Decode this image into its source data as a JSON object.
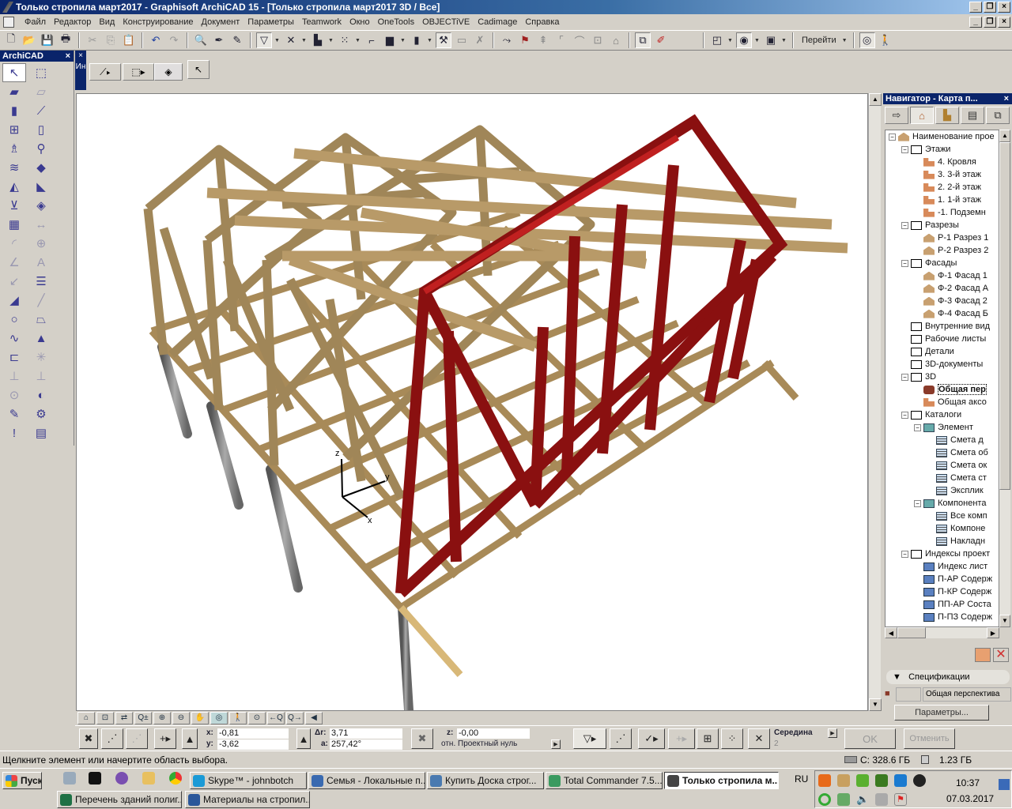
{
  "window": {
    "title": "Только стропила март2017 - Graphisoft ArchiCAD 15 - [Только стропила март2017 3D / Все]",
    "min_icon": "minimize-icon",
    "restore_icon": "restore-icon",
    "close_icon": "close-icon"
  },
  "menu": [
    "Файл",
    "Редактор",
    "Вид",
    "Конструирование",
    "Документ",
    "Параметры",
    "Teamwork",
    "Окно",
    "OneTools",
    "OBJECTiVE",
    "Cadimage",
    "Справка"
  ],
  "toolbar": {
    "goto_label": "Перейти",
    "icons": [
      "new-file",
      "open-file",
      "save",
      "print",
      "cut",
      "copy",
      "paste",
      "undo",
      "redo",
      "find-select",
      "eyedropper",
      "syringe",
      "magic-wand",
      "trim",
      "elevation",
      "snap-grid",
      "ruler-grid",
      "layers",
      "element-height",
      "magic-select",
      "coordinate-grid",
      "close-tool",
      "offset",
      "drag",
      "lift",
      "corner",
      "curve",
      "group",
      "house",
      "3d-window",
      "pen-sets"
    ]
  },
  "palette": {
    "title": "ArchiCAD",
    "close": "×",
    "tools": [
      {
        "name": "arrow-tool",
        "glyph": "↖",
        "sel": true
      },
      {
        "name": "marquee-tool",
        "glyph": "⬚"
      },
      {
        "name": "wall-tool",
        "glyph": "▰"
      },
      {
        "name": "curtain-wall-tool",
        "glyph": "▱",
        "dim": true
      },
      {
        "name": "column-tool",
        "glyph": "▮"
      },
      {
        "name": "beam-tool",
        "glyph": "⟋"
      },
      {
        "name": "window-tool",
        "glyph": "⊞"
      },
      {
        "name": "door-tool",
        "glyph": "▯"
      },
      {
        "name": "object-tool",
        "glyph": "♗"
      },
      {
        "name": "lamp-tool",
        "glyph": "⚲"
      },
      {
        "name": "stair-tool",
        "glyph": "≋"
      },
      {
        "name": "slab-tool",
        "glyph": "◆"
      },
      {
        "name": "roof-tool",
        "glyph": "◭"
      },
      {
        "name": "shell-tool",
        "glyph": "◣"
      },
      {
        "name": "mesh-tool",
        "glyph": "⊻"
      },
      {
        "name": "zone-tool",
        "glyph": "◈"
      },
      {
        "name": "grid-tool",
        "glyph": "▦"
      },
      {
        "name": "dimension-tool",
        "glyph": "↔",
        "dim": true
      },
      {
        "name": "radial-dimension-tool",
        "glyph": "◜",
        "dim": true
      },
      {
        "name": "level-dimension-tool",
        "glyph": "⊕",
        "dim": true
      },
      {
        "name": "angle-dimension-tool",
        "glyph": "∠",
        "dim": true
      },
      {
        "name": "text-tool",
        "glyph": "A",
        "dim": true
      },
      {
        "name": "label-tool",
        "glyph": "↙",
        "dim": true
      },
      {
        "name": "section-marker-tool",
        "glyph": "☰"
      },
      {
        "name": "fill-tool",
        "glyph": "◢"
      },
      {
        "name": "line-tool",
        "glyph": "╱",
        "dim": true
      },
      {
        "name": "circle-tool",
        "glyph": "○"
      },
      {
        "name": "polyline-tool",
        "glyph": "⏢"
      },
      {
        "name": "spline-tool",
        "glyph": "∿"
      },
      {
        "name": "figure-tool",
        "glyph": "▲"
      },
      {
        "name": "section-tool",
        "glyph": "⊏"
      },
      {
        "name": "hotspot-tool",
        "glyph": "✳",
        "dim": true
      },
      {
        "name": "elevation-tool",
        "glyph": "⊥",
        "dim": true
      },
      {
        "name": "interior-elevation-tool",
        "glyph": "⊥",
        "dim": true
      },
      {
        "name": "detail-tool",
        "glyph": "⊙",
        "dim": true
      },
      {
        "name": "worksheet-tool",
        "glyph": "◐"
      },
      {
        "name": "change-tool",
        "glyph": "✎"
      },
      {
        "name": "camera-tool",
        "glyph": "⚙"
      },
      {
        "name": "revision-tool",
        "glyph": "!"
      },
      {
        "name": "drawing-tool",
        "glyph": "▤"
      }
    ]
  },
  "infobox": {
    "vertical_label": "Ин",
    "close": "×"
  },
  "axes": {
    "x": "x",
    "y": "y",
    "z": "z"
  },
  "viewbar_icons": [
    "navigator-preview",
    "zoom-window",
    "fit",
    "zoom-pm",
    "zoom-in",
    "zoom-out",
    "pan",
    "orbit",
    "walk",
    "fit-in-window",
    "previous-zoom",
    "next-zoom",
    "scroll-left"
  ],
  "navigator": {
    "title": "Навигатор - Карта п...",
    "close": "×",
    "tree": [
      {
        "d": 0,
        "t": "-",
        "i": "house",
        "l": "Наименование прое"
      },
      {
        "d": 1,
        "t": "-",
        "i": "box",
        "l": "Этажи"
      },
      {
        "d": 2,
        "i": "story",
        "l": "4. Кровля"
      },
      {
        "d": 2,
        "i": "story",
        "l": "3. 3-й этаж"
      },
      {
        "d": 2,
        "i": "story",
        "l": "2. 2-й этаж"
      },
      {
        "d": 2,
        "i": "story",
        "l": "1. 1-й этаж"
      },
      {
        "d": 2,
        "i": "story",
        "l": "-1. Подземн"
      },
      {
        "d": 1,
        "t": "-",
        "i": "box",
        "l": "Разрезы"
      },
      {
        "d": 2,
        "i": "house",
        "l": "Р-1 Разрез 1"
      },
      {
        "d": 2,
        "i": "house",
        "l": "Р-2 Разрез 2"
      },
      {
        "d": 1,
        "t": "-",
        "i": "box",
        "l": "Фасады"
      },
      {
        "d": 2,
        "i": "house",
        "l": "Ф-1 Фасад 1"
      },
      {
        "d": 2,
        "i": "house",
        "l": "Ф-2 Фасад А"
      },
      {
        "d": 2,
        "i": "house",
        "l": "Ф-3 Фасад 2"
      },
      {
        "d": 2,
        "i": "house",
        "l": "Ф-4 Фасад Б"
      },
      {
        "d": 1,
        "i": "box",
        "l": "Внутренние вид"
      },
      {
        "d": 1,
        "i": "sheet",
        "l": "Рабочие листы"
      },
      {
        "d": 1,
        "i": "sheet",
        "l": "Детали"
      },
      {
        "d": 1,
        "i": "box",
        "l": "3D-документы"
      },
      {
        "d": 1,
        "t": "-",
        "i": "box",
        "l": "3D"
      },
      {
        "d": 2,
        "i": "cam",
        "l": "Общая пер",
        "bold": true
      },
      {
        "d": 2,
        "i": "story",
        "l": "Общая аксо"
      },
      {
        "d": 1,
        "t": "-",
        "i": "box",
        "l": "Каталоги"
      },
      {
        "d": 2,
        "t": "-",
        "i": "folder",
        "l": "Элемент"
      },
      {
        "d": 3,
        "i": "grid",
        "l": "Смета д"
      },
      {
        "d": 3,
        "i": "grid",
        "l": "Смета об"
      },
      {
        "d": 3,
        "i": "grid",
        "l": "Смета ок"
      },
      {
        "d": 3,
        "i": "grid",
        "l": "Смета ст"
      },
      {
        "d": 3,
        "i": "grid",
        "l": "Эксплик"
      },
      {
        "d": 2,
        "t": "-",
        "i": "folder",
        "l": "Компонента"
      },
      {
        "d": 3,
        "i": "grid",
        "l": "Все комп"
      },
      {
        "d": 3,
        "i": "grid",
        "l": "Компоне"
      },
      {
        "d": 3,
        "i": "grid",
        "l": "Накладн"
      },
      {
        "d": 1,
        "t": "-",
        "i": "box",
        "l": "Индексы проект"
      },
      {
        "d": 2,
        "i": "idx",
        "l": "Индекс лист"
      },
      {
        "d": 2,
        "i": "idx",
        "l": "П-АР Содерж"
      },
      {
        "d": 2,
        "i": "idx",
        "l": "П-КР Содерж"
      },
      {
        "d": 2,
        "i": "idx",
        "l": "ПП-АР Соста"
      },
      {
        "d": 2,
        "i": "idx",
        "l": "П-ПЗ Содерж"
      }
    ],
    "spec_label": "Спецификации",
    "view_name": "Общая перспектива",
    "params_button": "Параметры..."
  },
  "coords": {
    "x_label": "x:",
    "x_value": "-0,81",
    "y_label": "y:",
    "y_value": "-3,62",
    "dr_label": "Δr:",
    "dr_value": "3,71",
    "a_label": "a:",
    "a_value": "257,42°",
    "z_label": "z:",
    "z_value": "-0,00",
    "ref_label": "отн. Проектный нуль",
    "snap_label": "Середина",
    "snap_value": "2",
    "ok_button": "OK",
    "cancel_button": "Отменить"
  },
  "status": {
    "message": "Щелкните элемент или начертите область выбора.",
    "disk": "C: 328.6 ГБ",
    "memory": "1.23 ГБ"
  },
  "taskbar": {
    "start": "Пуск",
    "buttons": [
      {
        "label": "Skype™ - johnbotch",
        "color": "#1a9ad6"
      },
      {
        "label": "Семья - Локальные п...",
        "color": "#3a6ab0"
      },
      {
        "label": "Купить Доска строг...",
        "color": "#4a7ab0"
      },
      {
        "label": "Total Commander 7.5...",
        "color": "#3a9a60"
      },
      {
        "label": "Только стропила м...",
        "color": "#444",
        "active": true
      },
      {
        "label": "Перечень зданий полиг...",
        "color": "#1e7145"
      },
      {
        "label": "Материалы на стропил...",
        "color": "#2b579a"
      }
    ],
    "lang": "RU",
    "time": "10:37",
    "date": "07.03.2017"
  },
  "colors": {
    "title_bar": "#0a246a",
    "timber": "#a08658",
    "timber_light": "#d8b878",
    "selected_truss": "#8a1010",
    "post": "#8a8a8a"
  }
}
